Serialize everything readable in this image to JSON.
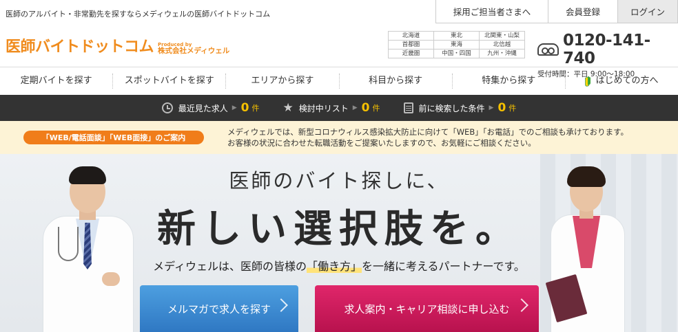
{
  "topbar": {
    "tagline": "医師のアルバイト・非常勤先を探すならメディウェルの医師バイトドットコム",
    "links": {
      "recruit": "採用ご担当者さまへ",
      "register": "会員登録",
      "login": "ログイン"
    }
  },
  "header": {
    "logo_main": "医師バイトドットコム",
    "logo_produced": "Produced by",
    "logo_company": "株式会社メディウェル",
    "regions": [
      [
        "北海道",
        "東北",
        "北関東・山梨"
      ],
      [
        "首都圏",
        "東海",
        "北信越"
      ],
      [
        "近畿圏",
        "中国・四国",
        "九州・沖縄"
      ]
    ],
    "phone_number": "0120-141-740",
    "phone_hours": "受付時間：平日 9:00〜18:00"
  },
  "nav": {
    "items": [
      "定期バイトを探す",
      "スポットバイトを探す",
      "エリアから探す",
      "科目から探す",
      "特集から探す",
      "はじめての方へ"
    ]
  },
  "darkbar": {
    "items": [
      {
        "label": "最近見た求人",
        "count": "0",
        "unit": "件",
        "icon": "clock-icon"
      },
      {
        "label": "検討中リスト",
        "count": "0",
        "unit": "件",
        "icon": "star-icon"
      },
      {
        "label": "前に検索した条件",
        "count": "0",
        "unit": "件",
        "icon": "calendar-icon"
      }
    ]
  },
  "notice": {
    "badge": "「WEB/電話面談」「WEB面接」のご案内",
    "line1": "メディウェルでは、新型コロナウィルス感染拡大防止に向けて「WEB」「お電話」でのご相談も承けております。",
    "line2": "お客様の状況に合わせた転職活動をご提案いたしますので、お気軽にご相談ください。"
  },
  "hero": {
    "title1": "医師のバイト探しに、",
    "title2": "新しい選択肢を。",
    "sub_before": "メディウェルは、医師の皆様の",
    "sub_highlight": "「働き方」",
    "sub_after": "を一緒に考えるパートナーです。",
    "btn_mail": "メルマガで求人を探す",
    "btn_apply": "求人案内・キャリア相談に申し込む"
  },
  "colors": {
    "brand_orange": "#f08c1e",
    "accent_yellow": "#f5c000",
    "mail_blue": "#2f78c3",
    "apply_magenta": "#c8165a"
  }
}
